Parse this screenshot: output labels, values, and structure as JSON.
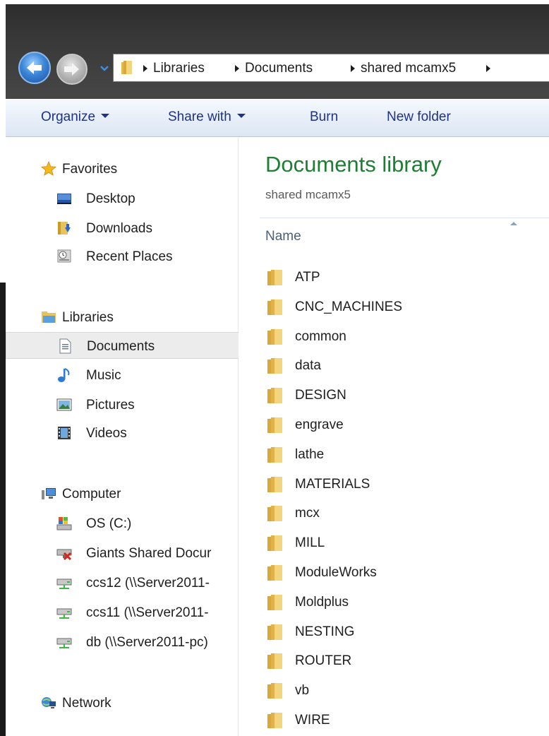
{
  "address_bar": {
    "breadcrumbs": [
      "Libraries",
      "Documents",
      "shared mcamx5"
    ]
  },
  "toolbar": {
    "organize": "Organize",
    "share_with": "Share with",
    "burn": "Burn",
    "new_folder": "New folder"
  },
  "nav": {
    "favorites": {
      "label": "Favorites",
      "items": [
        "Desktop",
        "Downloads",
        "Recent Places"
      ]
    },
    "libraries": {
      "label": "Libraries",
      "items": [
        "Documents",
        "Music",
        "Pictures",
        "Videos"
      ],
      "selected": "Documents"
    },
    "computer": {
      "label": "Computer",
      "items": [
        "OS (C:)",
        "Giants Shared Docur",
        "ccs12 (\\\\Server2011-",
        "ccs11 (\\\\Server2011-",
        "db (\\\\Server2011-pc)"
      ]
    },
    "network": {
      "label": "Network"
    }
  },
  "main": {
    "title": "Documents library",
    "subtitle": "shared mcamx5",
    "column_name": "Name",
    "files": [
      "ATP",
      "CNC_MACHINES",
      "common",
      "data",
      "DESIGN",
      "engrave",
      "lathe",
      "MATERIALS",
      "mcx",
      "MILL",
      "ModuleWorks",
      "Moldplus",
      "NESTING",
      "ROUTER",
      "vb",
      "WIRE"
    ]
  },
  "colors": {
    "title_green": "#1e7e34",
    "toolbar_text": "#1e3287",
    "folder_yellow": "#e8c25a"
  }
}
